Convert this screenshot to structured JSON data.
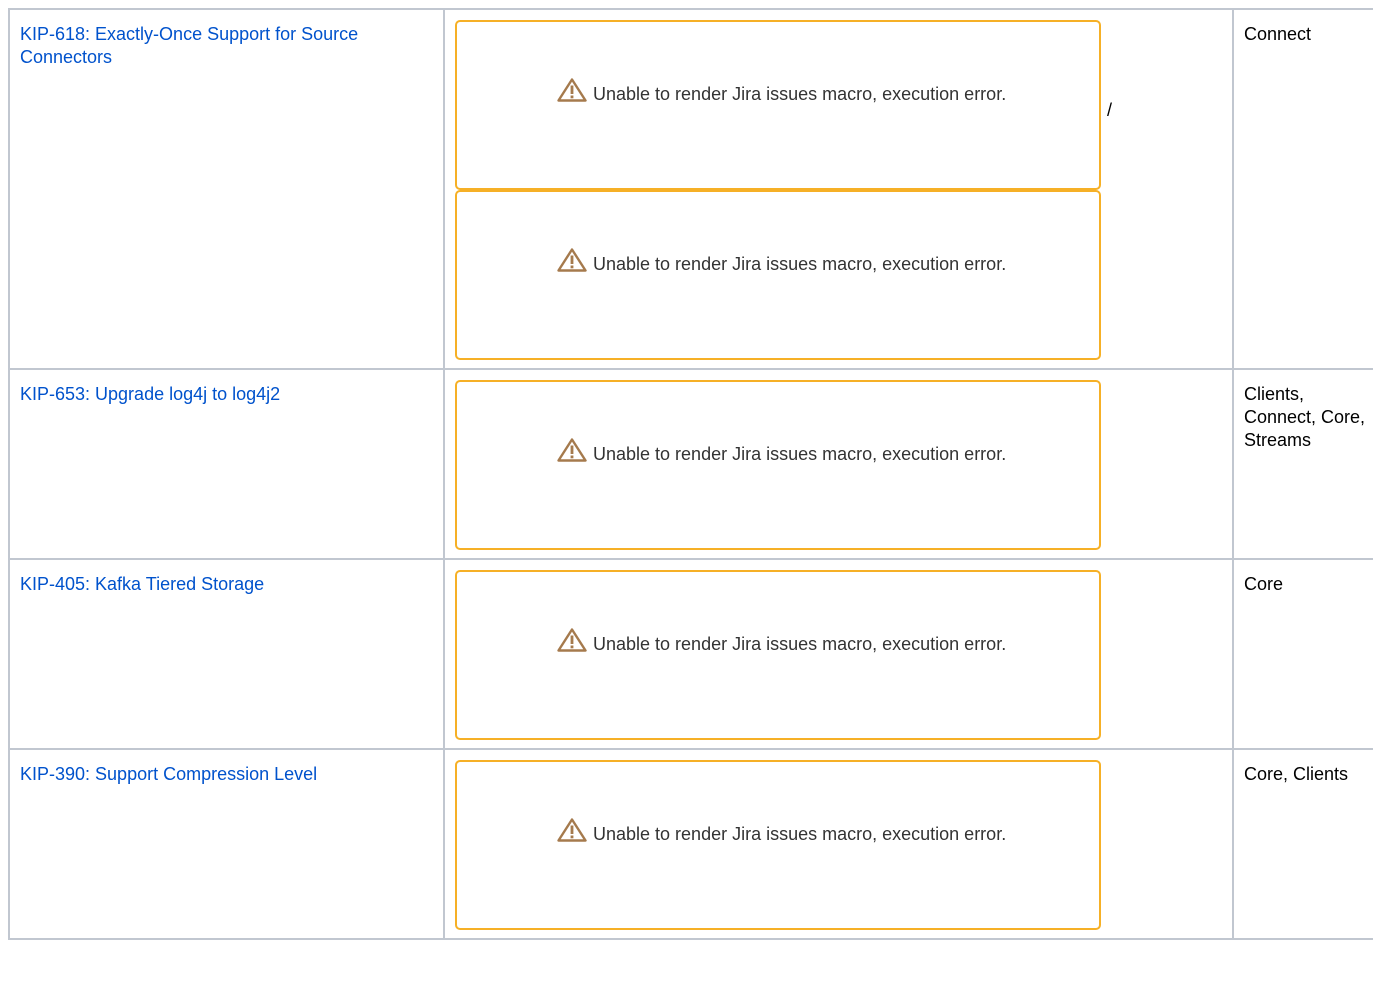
{
  "rows": [
    {
      "kip": "KIP-618: Exactly-Once Support for Source Connectors",
      "components": "Connect",
      "separator": "/",
      "macros": [
        {
          "icon": "warning-icon",
          "message": "Unable to render Jira issues macro, execution error."
        },
        {
          "icon": "warning-icon",
          "message": "Unable to render Jira issues macro, execution error."
        }
      ]
    },
    {
      "kip": "KIP-653: Upgrade log4j to log4j2",
      "components": "Clients, Connect, Core, Streams",
      "macros": [
        {
          "icon": "warning-icon",
          "message": "Unable to render Jira issues macro, execution error."
        }
      ]
    },
    {
      "kip": "KIP-405: Kafka Tiered Storage",
      "components": "Core",
      "macros": [
        {
          "icon": "warning-icon",
          "message": "Unable to render Jira issues macro, execution error."
        }
      ]
    },
    {
      "kip": "KIP-390: Support Compression Level",
      "components": "Core, Clients",
      "macros": [
        {
          "icon": "warning-icon",
          "message": "Unable to render Jira issues macro, execution error."
        }
      ]
    }
  ],
  "colors": {
    "link": "#0052cc",
    "macro_border": "#f6b026",
    "table_border": "#c1c7d0",
    "warning_icon_fill": "#a57a4d"
  }
}
